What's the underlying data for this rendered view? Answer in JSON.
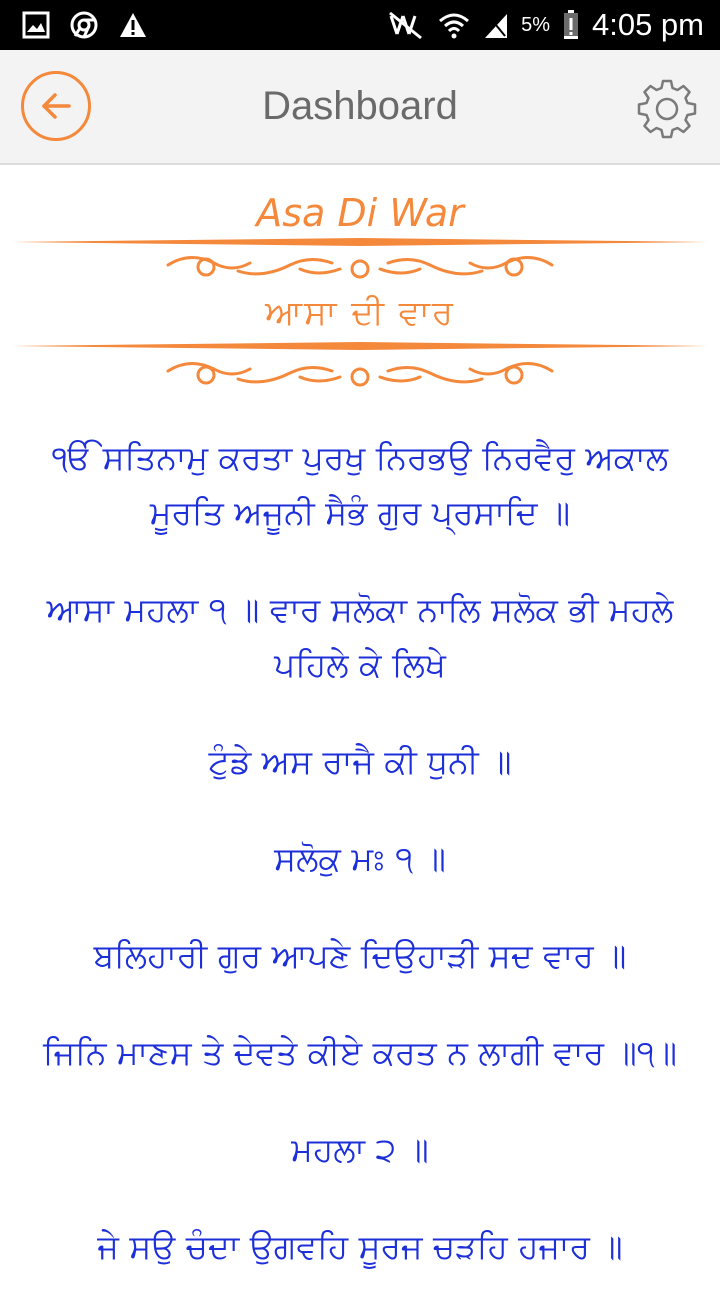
{
  "status_bar": {
    "battery_percent": "5%",
    "time": "4:05 pm",
    "icons": [
      "gallery-icon",
      "chrome-icon",
      "warning-icon",
      "mute-icon",
      "wifi-icon",
      "signal-icon",
      "battery-icon"
    ]
  },
  "app_bar": {
    "title": "Dashboard",
    "back_icon": "arrow-left-icon",
    "settings_icon": "gear-icon"
  },
  "header": {
    "title_en": "Asa Di War",
    "title_pa": "ਆਸਾ ਦੀ ਵਾਰ"
  },
  "colors": {
    "accent": "#f4883b",
    "verse_text": "#1c2fd8",
    "appbar_bg": "#f3f3f3"
  },
  "verses": [
    "ੴ ਸਤਿਨਾਮੁ ਕਰਤਾ ਪੁਰਖੁ ਨਿਰਭਉ ਨਿਰਵੈਰੁ ਅਕਾਲ ਮੂਰਤਿ ਅਜੂਨੀ ਸੈਭੰ ਗੁਰ ਪ੍ਰਸਾਦਿ ॥",
    "ਆਸਾ ਮਹਲਾ ੧ ॥ ਵਾਰ ਸਲੋਕਾ ਨਾਲਿ ਸਲੋਕ ਭੀ ਮਹਲੇ ਪਹਿਲੇ ਕੇ ਲਿਖੇ",
    "ਟੁੰਡੇ ਅਸ ਰਾਜੈ ਕੀ ਧੁਨੀ ॥",
    "ਸਲੋਕੁ ਮਃ ੧ ॥",
    "ਬਲਿਹਾਰੀ ਗੁਰ ਆਪਣੇ ਦਿਉਹਾੜੀ ਸਦ ਵਾਰ ॥",
    "ਜਿਨਿ ਮਾਣਸ ਤੇ ਦੇਵਤੇ ਕੀਏ ਕਰਤ ਨ ਲਾਗੀ ਵਾਰ ॥੧॥",
    "ਮਹਲਾ ੨ ॥",
    "ਜੇ ਸਉ ਚੰਦਾ ਉਗਵਹਿ ਸੂਰਜ ਚੜਹਿ ਹਜਾਰ ॥"
  ]
}
